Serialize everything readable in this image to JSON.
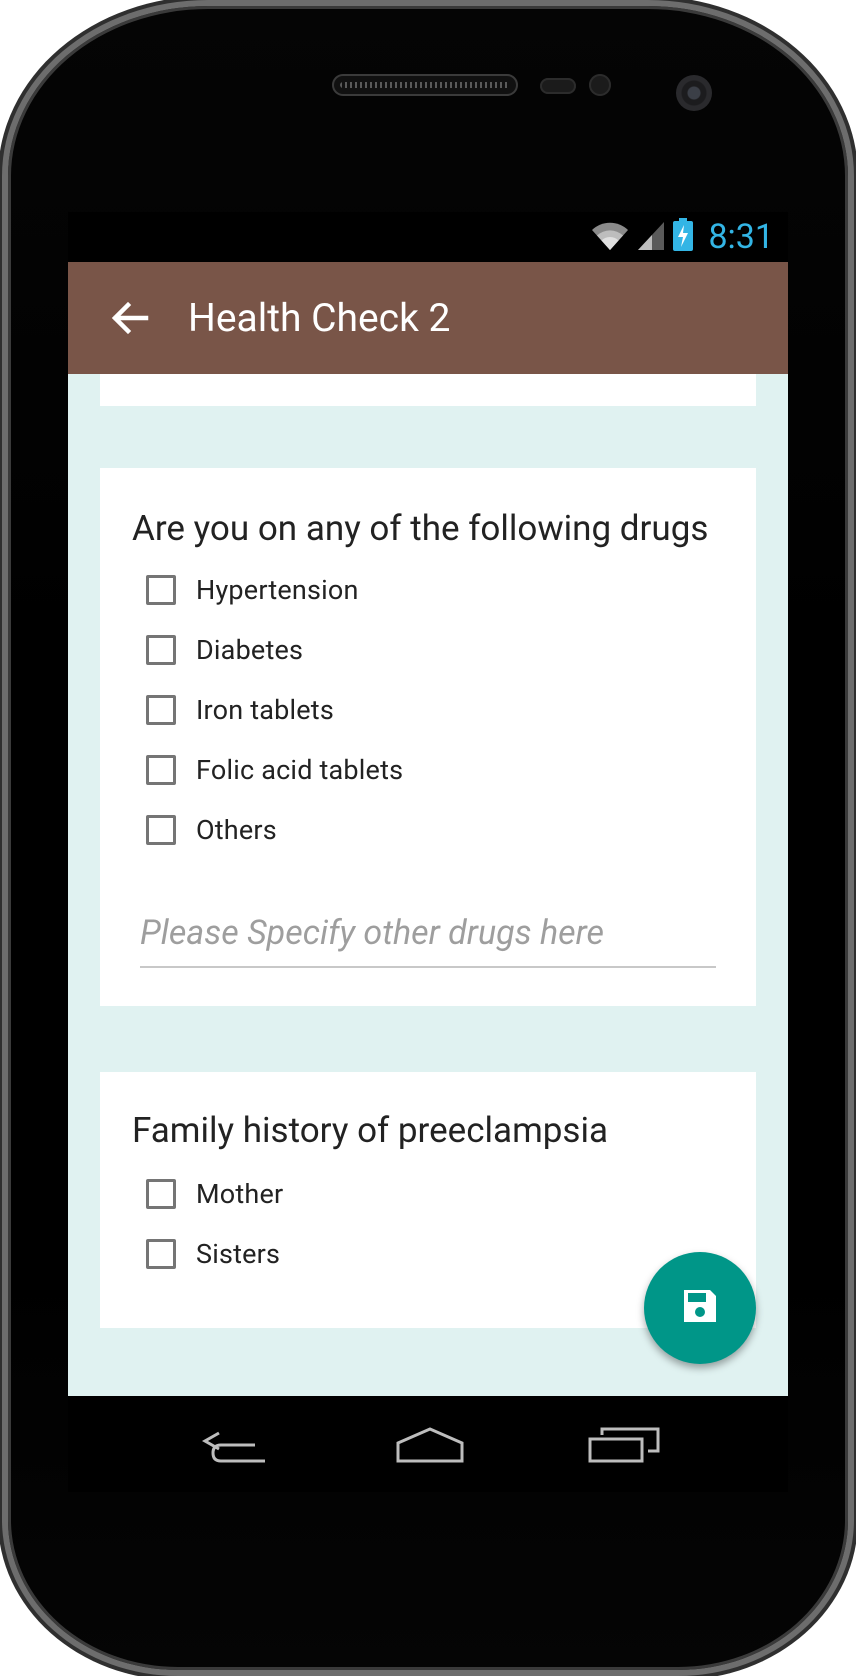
{
  "status_bar": {
    "time": "8:31",
    "icons": [
      "wifi-icon",
      "signal-icon",
      "battery-charging-icon"
    ],
    "time_color": "#33b5e5"
  },
  "app_bar": {
    "title": "Health Check 2",
    "back_icon": "arrow-left-icon",
    "color": "#795548"
  },
  "content": {
    "background": "#e0f2f1",
    "drugs_card": {
      "question": "Are you on any of the following drugs",
      "options": [
        {
          "label": "Hypertension",
          "checked": false
        },
        {
          "label": "Diabetes",
          "checked": false
        },
        {
          "label": "Iron tablets",
          "checked": false
        },
        {
          "label": "Folic acid tablets",
          "checked": false
        },
        {
          "label": "Others",
          "checked": false
        }
      ],
      "other_input": {
        "value": "",
        "placeholder": "Please Specify other drugs here"
      }
    },
    "family_card": {
      "question": "Family history of preeclampsia",
      "options": [
        {
          "label": "Mother",
          "checked": false
        },
        {
          "label": "Sisters",
          "checked": false
        }
      ]
    }
  },
  "fab": {
    "icon": "save-icon",
    "color": "#009688"
  },
  "nav_bar": {
    "buttons": [
      "back-nav-icon",
      "home-nav-icon",
      "recents-nav-icon"
    ]
  }
}
